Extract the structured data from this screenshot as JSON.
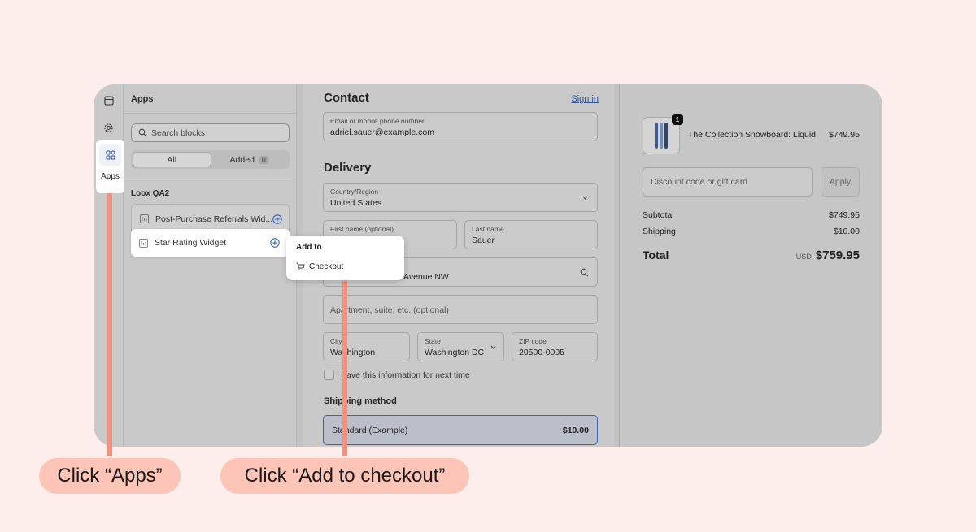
{
  "rail": {
    "apps_label": "Apps"
  },
  "panel": {
    "title": "Apps",
    "search_placeholder": "Search blocks",
    "tabs": [
      {
        "label": "All"
      },
      {
        "label": "Added",
        "count": "0"
      }
    ],
    "group_label": "Loox QA2",
    "blocks": [
      {
        "label": "Post-Purchase Referrals Wid..."
      },
      {
        "label": "Star Rating Widget"
      }
    ]
  },
  "popover": {
    "title": "Add to",
    "item": "Checkout"
  },
  "checkout": {
    "contact_heading": "Contact",
    "sign_in": "Sign in",
    "email_label": "Email or mobile phone number",
    "email_value": "adriel.sauer@example.com",
    "delivery_heading": "Delivery",
    "country_label": "Country/Region",
    "country_value": "United States",
    "first_name_label": "First name (optional)",
    "last_name_label": "Last name",
    "last_name_value": "Sauer",
    "address_value": "Avenue NW",
    "apartment_placeholder": "Apartment, suite, etc. (optional)",
    "city_label": "City",
    "city_value": "Washington",
    "state_label": "State",
    "state_value": "Washington DC",
    "zip_label": "ZIP code",
    "zip_value": "20500-0005",
    "save_info": "Save this information for next time",
    "shipping_heading": "Shipping method",
    "shipping_option": "Standard (Example)",
    "shipping_price": "$10.00"
  },
  "summary": {
    "quantity": "1",
    "product_name": "The Collection Snowboard: Liquid",
    "product_price": "$749.95",
    "discount_placeholder": "Discount code or gift card",
    "apply_label": "Apply",
    "subtotal_label": "Subtotal",
    "subtotal_value": "$749.95",
    "shipping_label": "Shipping",
    "shipping_value": "$10.00",
    "total_label": "Total",
    "currency": "USD",
    "total_value": "$759.95"
  },
  "annotations": {
    "step1": "Click “Apps”",
    "step2": "Click “Add to checkout”"
  },
  "colors": {
    "background": "#fdeeeb",
    "annotation_pill": "#fcc5b8",
    "annotation_line": "#f5917e",
    "accent_blue": "#3a63b5"
  }
}
